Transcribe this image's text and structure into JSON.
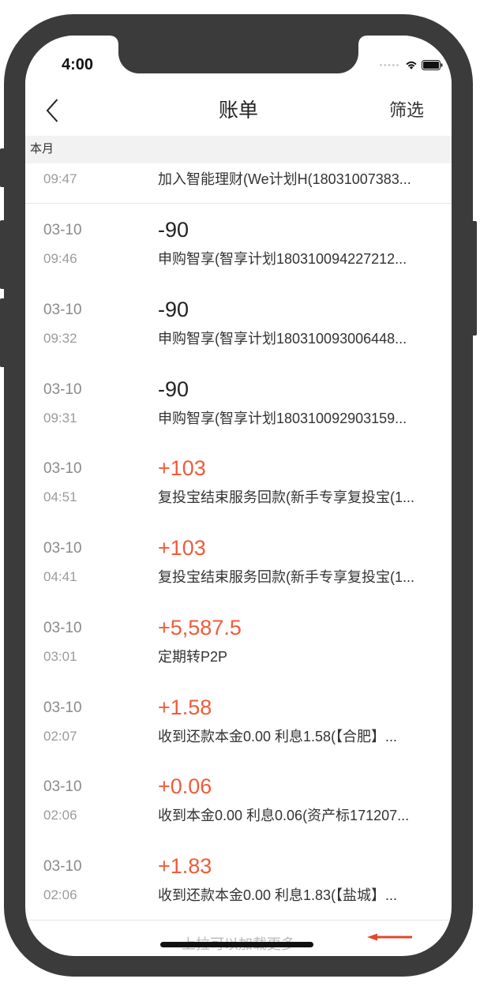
{
  "status_bar": {
    "time": "4:00",
    "icons": [
      "signal-dots-icon",
      "wifi-icon",
      "battery-icon"
    ]
  },
  "nav": {
    "back_icon": "chevron-left-icon",
    "title": "账单",
    "filter_label": "筛选"
  },
  "section": {
    "title": "本月"
  },
  "partial_row": {
    "time": "09:47",
    "description": "加入智能理财(We计划H(18031007383..."
  },
  "transactions": [
    {
      "date": "03-10",
      "amount": "-90",
      "time": "09:46",
      "description": "申购智享(智享计划180310094227212..."
    },
    {
      "date": "03-10",
      "amount": "-90",
      "time": "09:32",
      "description": "申购智享(智享计划180310093006448..."
    },
    {
      "date": "03-10",
      "amount": "-90",
      "time": "09:31",
      "description": "申购智享(智享计划180310092903159..."
    },
    {
      "date": "03-10",
      "amount": "+103",
      "time": "04:51",
      "description": "复投宝结束服务回款(新手专享复投宝(1..."
    },
    {
      "date": "03-10",
      "amount": "+103",
      "time": "04:41",
      "description": "复投宝结束服务回款(新手专享复投宝(1..."
    },
    {
      "date": "03-10",
      "amount": "+5,587.5",
      "time": "03:01",
      "description": "定期转P2P"
    },
    {
      "date": "03-10",
      "amount": "+1.58",
      "time": "02:07",
      "description": "收到还款本金0.00 利息1.58(【合肥】..."
    },
    {
      "date": "03-10",
      "amount": "+0.06",
      "time": "02:06",
      "description": "收到本金0.00 利息0.06(资产标171207..."
    },
    {
      "date": "03-10",
      "amount": "+1.83",
      "time": "02:06",
      "description": "收到还款本金0.00 利息1.83(【盐城】..."
    }
  ],
  "footer": {
    "load_more": "上拉可以加载更多"
  },
  "annotation": {
    "arrow_icon": "arrow-left-icon"
  },
  "colors": {
    "income": "#f05b3a",
    "expense": "#222222",
    "phone_frame": "#3b3b3b",
    "annotation_arrow": "#e2472c"
  }
}
